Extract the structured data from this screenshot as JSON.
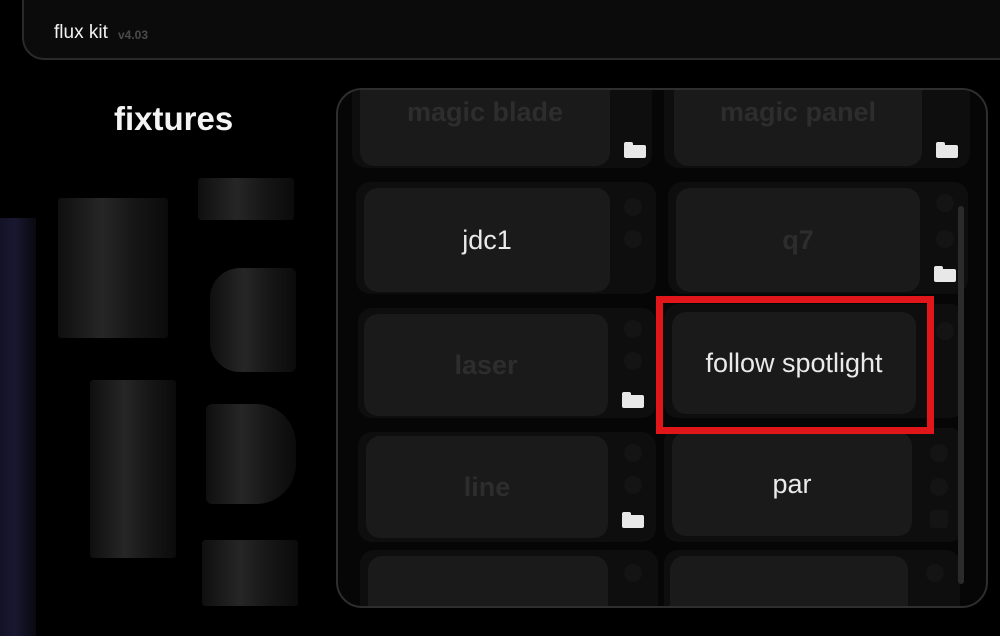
{
  "app": {
    "title": "flux kit",
    "version": "v4.03"
  },
  "sidebar": {
    "title": "fixtures"
  },
  "fixtures": {
    "row0": {
      "left": "magic blade",
      "right": "magic panel"
    },
    "row1": {
      "left": "jdc1",
      "right": "q7"
    },
    "row2": {
      "left": "laser",
      "right": "follow spotlight"
    },
    "row3": {
      "left": "line",
      "right": "par"
    }
  },
  "icons": {
    "folder": "folder-icon",
    "clock": "clock-icon",
    "user": "user-icon",
    "calendar": "calendar-icon"
  },
  "colors": {
    "highlight": "#e0161b",
    "card": "#1a1a1a",
    "dim_text": "#2d2d2d"
  }
}
